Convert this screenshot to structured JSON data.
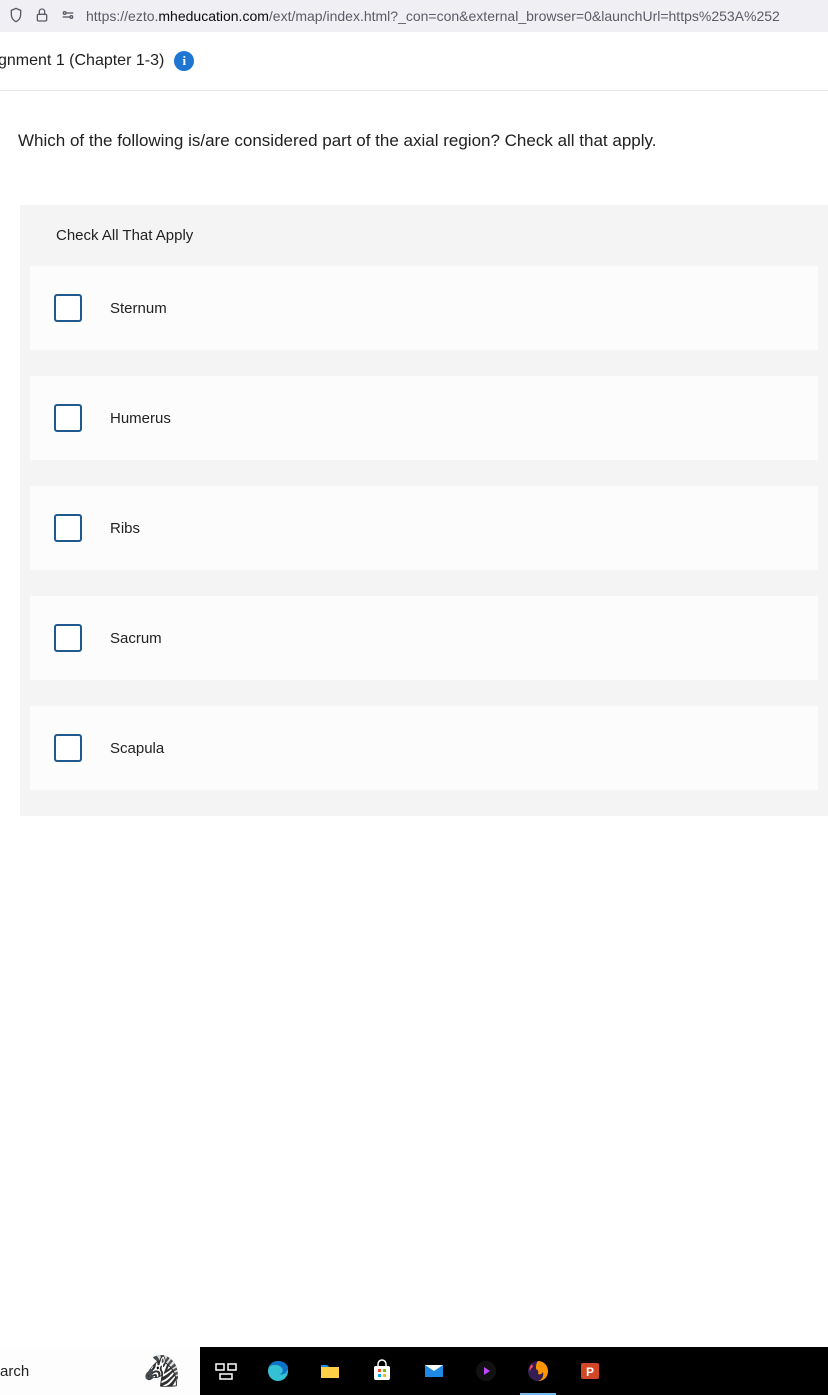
{
  "browser": {
    "url_protocol": "https://",
    "url_sub": "ezto.",
    "url_domain": "mheducation.com",
    "url_path": "/ext/map/index.html?_con=con&external_browser=0&launchUrl=https%253A%252"
  },
  "header": {
    "assignment_title": "gnment 1 (Chapter 1-3)"
  },
  "question": {
    "prompt": "Which of the following is/are considered part of the axial region? Check all that apply.",
    "panel_title": "Check All That Apply",
    "options": [
      {
        "label": "Sternum"
      },
      {
        "label": "Humerus"
      },
      {
        "label": "Ribs"
      },
      {
        "label": "Sacrum"
      },
      {
        "label": "Scapula"
      }
    ]
  },
  "taskbar": {
    "search_text": "arch"
  }
}
